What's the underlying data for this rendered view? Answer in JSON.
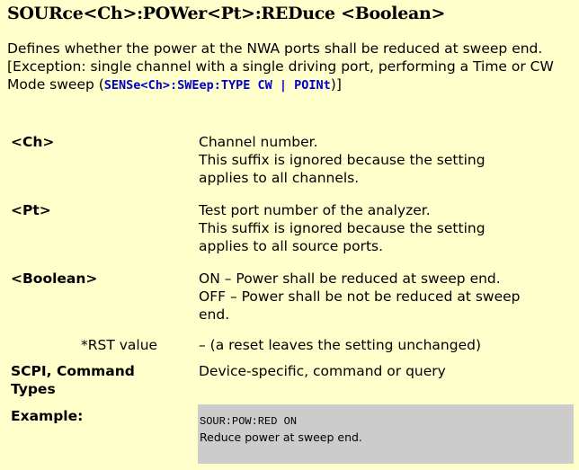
{
  "title": "SOURce<Ch>:POWer<Pt>:REDuce <Boolean>",
  "description": "Defines whether the power at the NWA ports shall be reduced at sweep end.",
  "exception_prefix": "[Exception: single channel with a single driving port, performing a Time or CW Mode sweep (",
  "exception_code": "SENSe<Ch>:SWEep:TYPE CW | POINt",
  "exception_suffix": ")]",
  "params": [
    {
      "name": "<Ch>",
      "lines": [
        "Channel number.",
        "This suffix is ignored because the setting",
        "applies to all channels."
      ]
    },
    {
      "name": "<Pt>",
      "lines": [
        "Test port number of the analyzer.",
        "This suffix is ignored because the setting",
        "applies to all source ports."
      ]
    },
    {
      "name": "<Boolean>",
      "lines": [
        "ON – Power shall be reduced at sweep end.",
        "OFF – Power shall be not be reduced at sweep",
        "end."
      ]
    }
  ],
  "rst": {
    "label": "*RST value",
    "value": "– (a reset leaves the setting unchanged)"
  },
  "scpi": {
    "label_line1": "SCPI, Command",
    "label_line2": "Types",
    "value": "Device-specific, command or query"
  },
  "example": {
    "label": "Example:",
    "code": "SOUR:POW:RED ON",
    "text": "Reduce power at sweep end."
  }
}
